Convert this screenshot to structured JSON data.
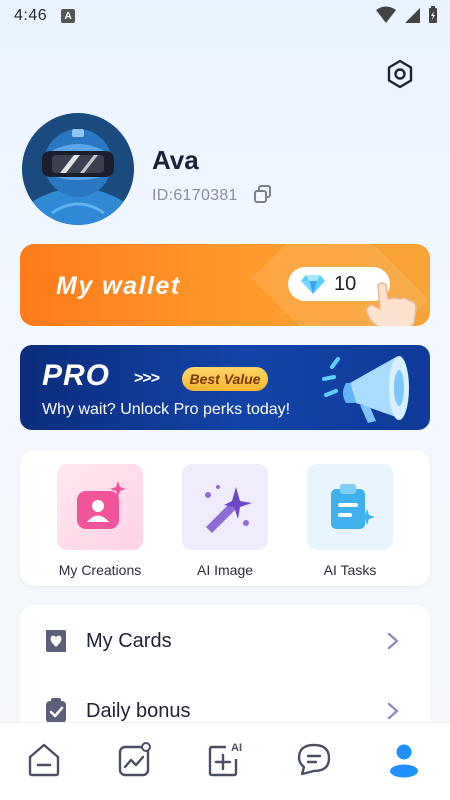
{
  "status_bar": {
    "time": "4:46",
    "notification": "A"
  },
  "profile": {
    "name": "Ava",
    "id_text": "ID:6170381"
  },
  "wallet": {
    "label": "My wallet",
    "diamonds": "10"
  },
  "pro_banner": {
    "title": "PRO",
    "arrows": ">>>",
    "badge": "Best Value",
    "subtitle": "Why wait? Unlock Pro perks today!"
  },
  "features": [
    {
      "label": "My Creations",
      "icon": "creations-icon"
    },
    {
      "label": "AI Image",
      "icon": "magic-wand-icon"
    },
    {
      "label": "AI Tasks",
      "icon": "clipboard-icon"
    }
  ],
  "menu": [
    {
      "label": "My Cards",
      "icon": "card-heart-icon"
    },
    {
      "label": "Daily bonus",
      "icon": "checklist-icon"
    }
  ],
  "bottom_nav": [
    {
      "name": "home-icon",
      "active": false
    },
    {
      "name": "gallery-icon",
      "active": false
    },
    {
      "name": "ai-create-icon",
      "active": false
    },
    {
      "name": "chat-icon",
      "active": false
    },
    {
      "name": "profile-icon",
      "active": true
    }
  ],
  "colors": {
    "accent": "#1e90ff",
    "wallet": "#ff8a1f",
    "pro": "#0b2d7c",
    "badge": "#ffcc4d"
  }
}
